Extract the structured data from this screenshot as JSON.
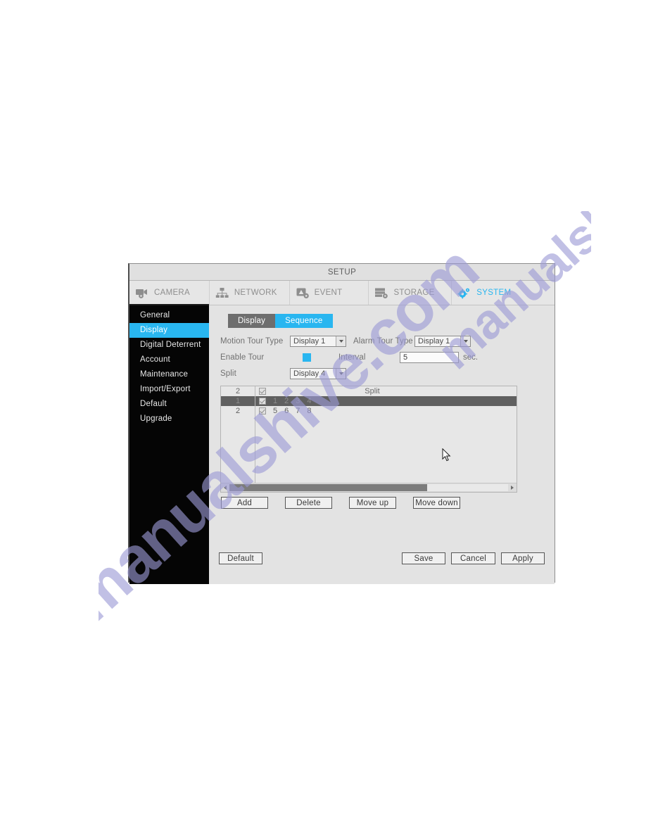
{
  "watermark": {
    "line1": "manualshive.com",
    "line2": "manualshive.com",
    "color": "#9c9ad6"
  },
  "window": {
    "title": "SETUP"
  },
  "theme": {
    "accent": "#29b6f0",
    "sidebar_bg": "#050505",
    "panel_bg": "#e3e3e3",
    "inactive_tab_bg": "#6e6e6e",
    "row_selected_bg": "#606060"
  },
  "topnav": {
    "items": [
      {
        "label": "CAMERA",
        "icon": "camera-gear-icon",
        "active": false,
        "underline": true
      },
      {
        "label": "NETWORK",
        "icon": "network-tree-icon",
        "active": false,
        "underline": false
      },
      {
        "label": "EVENT",
        "icon": "event-alert-icon",
        "active": false,
        "underline": false
      },
      {
        "label": "STORAGE",
        "icon": "storage-gear-icon",
        "active": false,
        "underline": false
      },
      {
        "label": "SYSTEM",
        "icon": "system-gear-icon",
        "active": true,
        "underline": false
      }
    ]
  },
  "sidebar": {
    "items": [
      {
        "label": "General",
        "active": false
      },
      {
        "label": "Display",
        "active": true
      },
      {
        "label": "Digital Deterrent",
        "active": false
      },
      {
        "label": "Account",
        "active": false
      },
      {
        "label": "Maintenance",
        "active": false
      },
      {
        "label": "Import/Export",
        "active": false
      },
      {
        "label": "Default",
        "active": false
      },
      {
        "label": "Upgrade",
        "active": false
      }
    ]
  },
  "subtabs": [
    {
      "label": "Display",
      "active": false
    },
    {
      "label": "Sequence",
      "active": true
    }
  ],
  "form": {
    "motion_tour_type_label": "Motion Tour Type",
    "motion_tour_type_value": "Display 1",
    "alarm_tour_type_label": "Alarm Tour Type",
    "alarm_tour_type_value": "Display 1",
    "enable_tour_label": "Enable Tour",
    "enable_tour_checked": true,
    "interval_label": "Interval",
    "interval_value": "5",
    "interval_unit": "sec.",
    "split_label": "Split",
    "split_value": "Display 4"
  },
  "table": {
    "column_header": "Split",
    "rows": [
      {
        "index": "2",
        "checked": true,
        "channels": [],
        "is_header": true,
        "selected": false
      },
      {
        "index": "1",
        "checked": true,
        "channels": [
          "1",
          "2",
          "3",
          "4"
        ],
        "is_header": false,
        "selected": true
      },
      {
        "index": "2",
        "checked": true,
        "channels": [
          "5",
          "6",
          "7",
          "8"
        ],
        "is_header": false,
        "selected": false
      }
    ],
    "scroll_thumb_percent": 71
  },
  "list_buttons": [
    {
      "label": "Add"
    },
    {
      "label": "Delete"
    },
    {
      "label": "Move up"
    },
    {
      "label": "Move down"
    }
  ],
  "footer_buttons": {
    "default_label": "Default",
    "save_label": "Save",
    "cancel_label": "Cancel",
    "apply_label": "Apply"
  }
}
